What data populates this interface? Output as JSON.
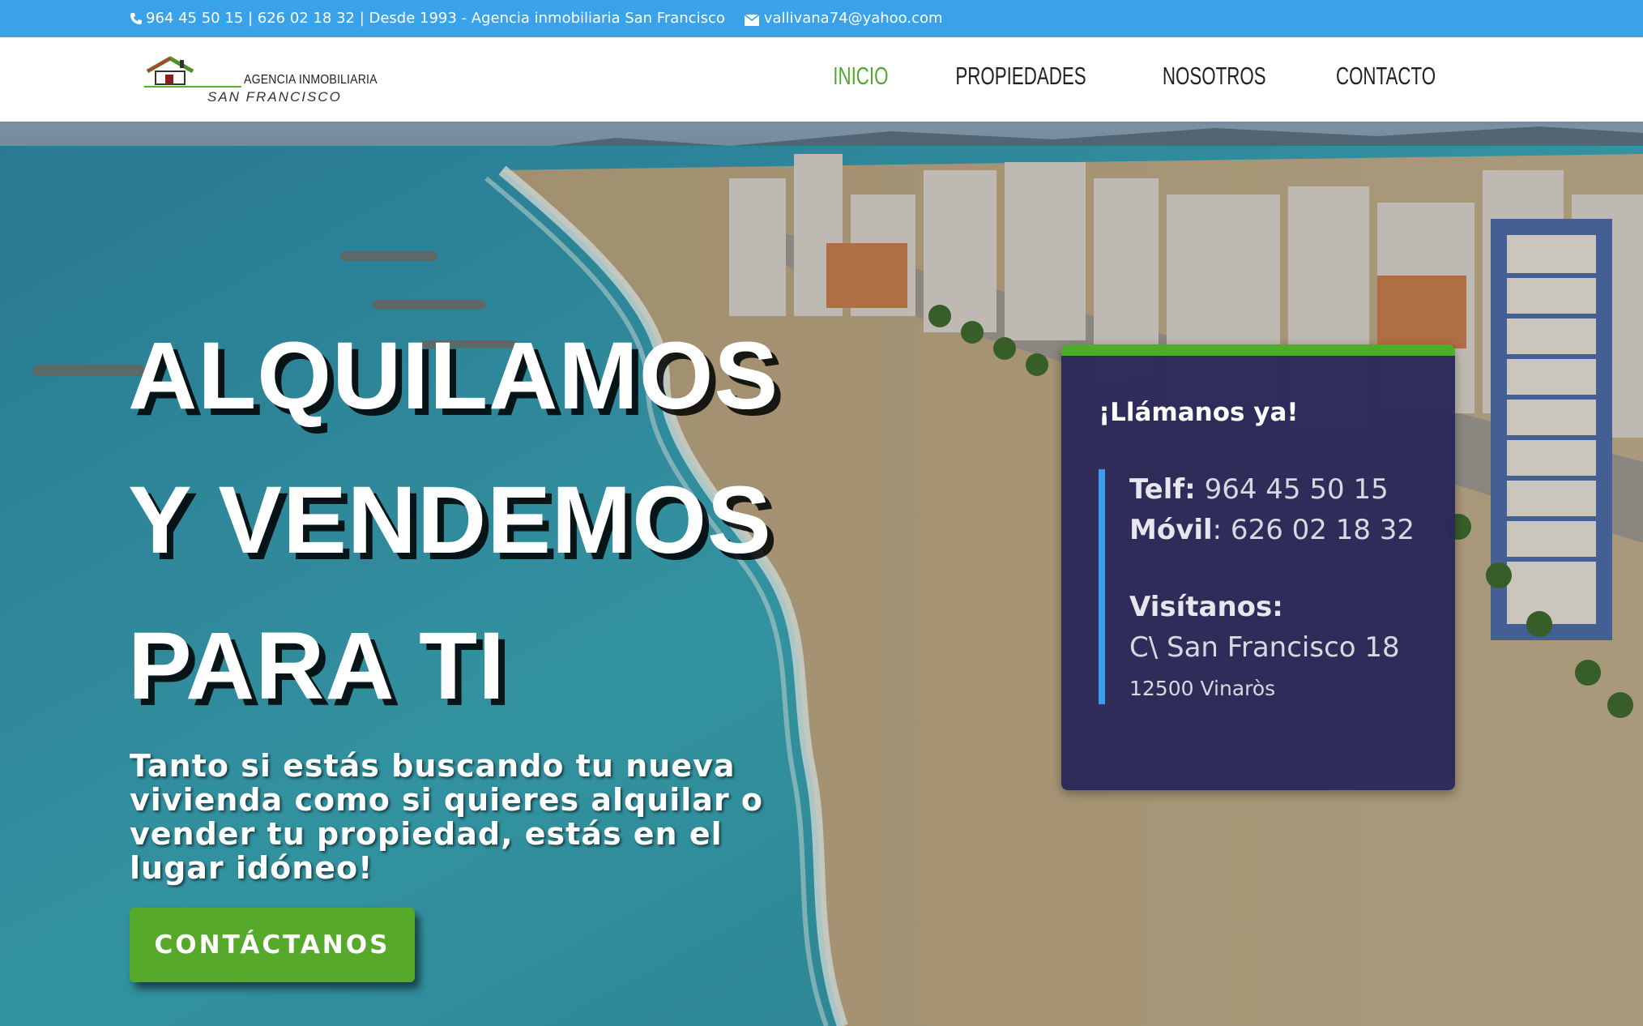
{
  "topbar": {
    "phone_text": "964 45 50 15 | 626 02 18 32 | Desde 1993 - Agencia inmobiliaria San Francisco",
    "email": "vallivana74@yahoo.com",
    "background": "#39a2e9"
  },
  "logo": {
    "line1": "AGENCIA INMOBILIARIA",
    "line2": "SAN FRANCISCO"
  },
  "nav": {
    "items": [
      "INICIO",
      "PROPIEDADES",
      "NOSOTROS",
      "CONTACTO"
    ],
    "active": "INICIO",
    "active_color": "#53a92b"
  },
  "hero": {
    "headline_1": "ALQUILAMOS",
    "headline_2": "Y VENDEMOS",
    "headline_3": "PARA TI",
    "subtitle": "Tanto si estás buscando tu nueva vivienda como si quieres alquilar o vender tu propiedad, estás en el lugar idóneo!",
    "cta_label": "CONTÁCTANOS",
    "cta_color": "#56a92b"
  },
  "contact_card": {
    "title": "¡Llámanos ya!",
    "telf_label": "Telf:",
    "telf_value": "964 45 50 15",
    "movil_label": "Móvil",
    "movil_value": ": 626 02 18 32",
    "visit_label": "Visítanos:",
    "address": "C\\ San Francisco 18",
    "city": "12500 Vinaròs",
    "background": "#2a2858",
    "accent_top": "#4eac27",
    "accent_bar": "#3b9eea"
  }
}
